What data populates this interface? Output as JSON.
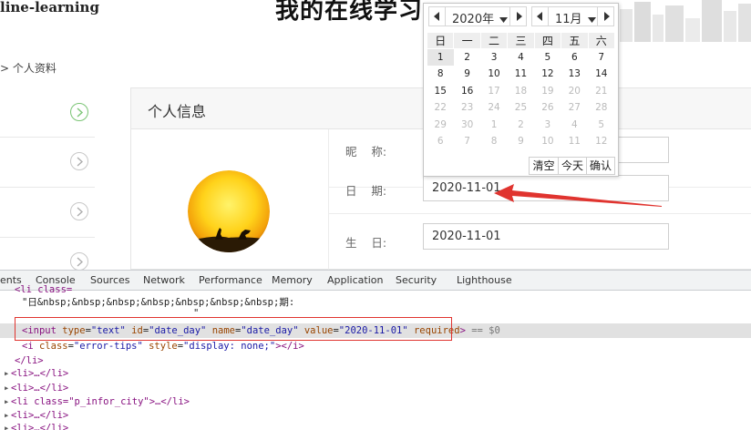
{
  "header": {
    "brand": "line-learning",
    "title": "我的在线学习"
  },
  "breadcrumb": "> 个人资料",
  "panel": {
    "title": "个人信息",
    "rows": [
      {
        "label": "昵    称:",
        "value": ""
      },
      {
        "label": "日    期:",
        "value": "2020-11-01"
      },
      {
        "label": "生    日:",
        "value": "2020-11-01"
      }
    ]
  },
  "datepicker": {
    "year": "2020年",
    "month": "11月",
    "weekdays": [
      "日",
      "一",
      "二",
      "三",
      "四",
      "五",
      "六"
    ],
    "weeks": [
      [
        [
          "1",
          "cur"
        ],
        [
          "2",
          "cur"
        ],
        [
          "3",
          "cur"
        ],
        [
          "4",
          "cur"
        ],
        [
          "5",
          "cur"
        ],
        [
          "6",
          "cur"
        ],
        [
          "7",
          "cur"
        ]
      ],
      [
        [
          "8",
          "cur"
        ],
        [
          "9",
          "cur"
        ],
        [
          "10",
          "cur"
        ],
        [
          "11",
          "cur"
        ],
        [
          "12",
          "cur"
        ],
        [
          "13",
          "cur"
        ],
        [
          "14",
          "cur"
        ]
      ],
      [
        [
          "15",
          "cur"
        ],
        [
          "16",
          "cur"
        ],
        [
          "17",
          "muted"
        ],
        [
          "18",
          "muted"
        ],
        [
          "19",
          "muted"
        ],
        [
          "20",
          "muted"
        ],
        [
          "21",
          "muted"
        ]
      ],
      [
        [
          "22",
          "muted"
        ],
        [
          "23",
          "muted"
        ],
        [
          "24",
          "muted"
        ],
        [
          "25",
          "muted"
        ],
        [
          "26",
          "muted"
        ],
        [
          "27",
          "muted"
        ],
        [
          "28",
          "muted"
        ]
      ],
      [
        [
          "29",
          "muted"
        ],
        [
          "30",
          "muted"
        ],
        [
          "1",
          "muted"
        ],
        [
          "2",
          "muted"
        ],
        [
          "3",
          "muted"
        ],
        [
          "4",
          "muted"
        ],
        [
          "5",
          "muted"
        ]
      ],
      [
        [
          "6",
          "muted"
        ],
        [
          "7",
          "muted"
        ],
        [
          "8",
          "muted"
        ],
        [
          "9",
          "muted"
        ],
        [
          "10",
          "muted"
        ],
        [
          "11",
          "muted"
        ],
        [
          "12",
          "muted"
        ]
      ]
    ],
    "selected_day": "1",
    "actions": [
      "清空",
      "今天",
      "确认"
    ]
  },
  "devtools": {
    "tabs": [
      "ents",
      "Console",
      "Sources",
      "Network",
      "Performance",
      "Memory",
      "Application",
      "Security",
      "Lighthouse"
    ],
    "line_label_text": "\"日&nbsp;&nbsp;&nbsp;&nbsp;&nbsp;&nbsp;&nbsp;期:",
    "line_quote": "\"",
    "input_line": {
      "open": "<input",
      "type_attr": "type",
      "type_val": "\"text\"",
      "id_attr": "id",
      "id_val": "\"date_day\"",
      "name_attr": "name",
      "name_val": "\"date_day\"",
      "value_attr": "value",
      "value_val": "\"2020-11-01\"",
      "required_attr": "required",
      "close": ">",
      "marker": "== $0"
    },
    "i_line": {
      "open": "<i",
      "class_attr": "class",
      "class_val": "\"error-tips\"",
      "style_attr": "style",
      "style_val": "\"display: none;\"",
      "close": "></i>"
    },
    "li_close": "</li>",
    "li_collapsed_1": "<li>…</li>",
    "li_collapsed_2": "<li>…</li>",
    "li_city": "<li class=\"p_infor_city\">…</li>",
    "li_collapsed_3": "<li>…</li>",
    "li_collapsed_4": "<li>…</li>"
  },
  "colors": {
    "accent_green": "#7cc576",
    "annotation_red": "#e0342f"
  }
}
